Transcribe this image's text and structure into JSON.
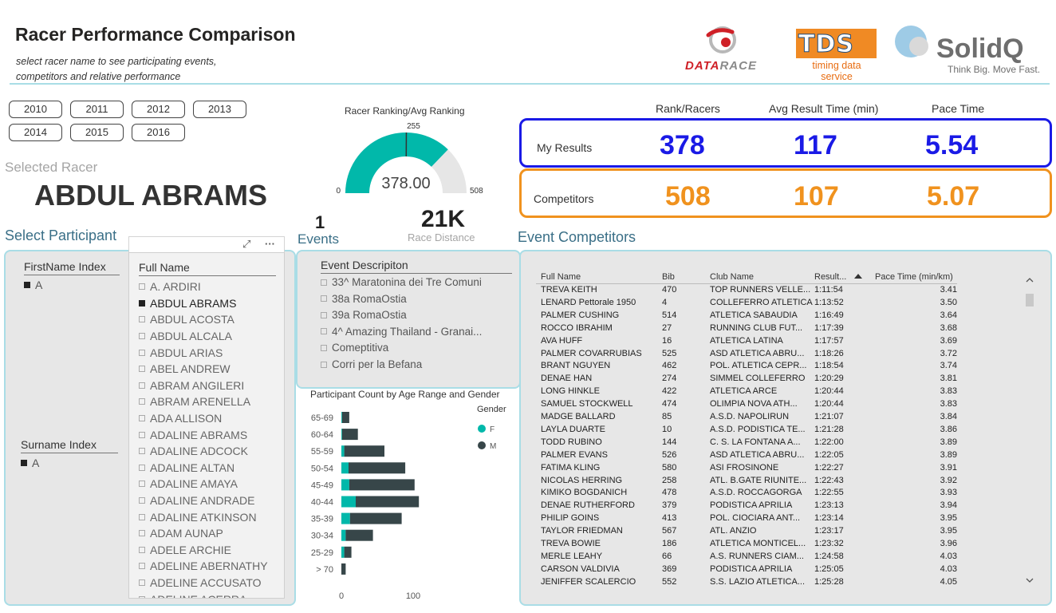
{
  "header": {
    "title": "Racer Performance Comparison",
    "subtitle": "select racer name to see participating events, competitors and relative performance"
  },
  "logos": {
    "datarace_a": "DATA",
    "datarace_b": "RACE",
    "tds": "TDS",
    "tds_tag": "timing data service",
    "solidq": "SolidQ",
    "solidq_tag": "Think Big. Move Fast."
  },
  "years": [
    "2010",
    "2011",
    "2012",
    "2013",
    "2014",
    "2015",
    "2016"
  ],
  "selected_racer": {
    "label": "Selected Racer",
    "name": "ABDUL ABRAMS"
  },
  "select_participant": {
    "title": "Select Participant",
    "firstname_index_label": "FirstName Index",
    "firstname_index_value": "A",
    "surname_index_label": "Surname Index",
    "surname_index_value": "A",
    "full_name_label": "Full Name",
    "names": [
      "A. ARDIRI",
      "ABDUL ABRAMS",
      "ABDUL ACOSTA",
      "ABDUL ALCALA",
      "ABDUL ARIAS",
      "ABEL ANDREW",
      "ABRAM ANGILERI",
      "ABRAM ARENELLA",
      "ADA ALLISON",
      "ADALINE ABRAMS",
      "ADALINE ADCOCK",
      "ADALINE ALTAN",
      "ADALINE AMAYA",
      "ADALINE ANDRADE",
      "ADALINE ATKINSON",
      "ADAM AUNAP",
      "ADELE ARCHIE",
      "ADELINE ABERNATHY",
      "ADELINE ACCUSATO",
      "ADELINE ACERRA"
    ],
    "selected_name": "ABDUL ABRAMS"
  },
  "gauge": {
    "title": "Racer Ranking/Avg Ranking",
    "value": 378,
    "value_label": "378.00",
    "min": 0,
    "max": 508,
    "target": 255,
    "min_label": "0",
    "max_label": "508",
    "target_label": "255",
    "fill_color": "#01b8aa",
    "track_color": "#e6e6e6"
  },
  "events_summary": {
    "count": "1",
    "label": "Events",
    "race_distance": "21K",
    "race_distance_label": "Race Distance"
  },
  "events": {
    "header": "Event Descripiton",
    "items": [
      "33^ Maratonina dei Tre Comuni",
      "38a RomaOstia",
      "39a RomaOstia",
      "4^ Amazing Thailand - Granai...",
      "Comeptitiva",
      "Corri per la Befana"
    ]
  },
  "kpi": {
    "headers": [
      "Rank/Racers",
      "Avg Result Time (min)",
      "Pace Time"
    ],
    "my_results": {
      "label": "My Results",
      "rank": "378",
      "avg_time": "117",
      "pace": "5.54",
      "color": "#1a1ae6"
    },
    "competitors": {
      "label": "Competitors",
      "rank": "508",
      "avg_time": "107",
      "pace": "5.07",
      "color": "#f0921e"
    }
  },
  "event_competitors": {
    "title": "Event Competitors",
    "columns": [
      "Full Name",
      "Bib",
      "Club Name",
      "Result...",
      "Pace Time (min/km)"
    ],
    "rows": [
      [
        "TREVA KEITH",
        "470",
        "TOP RUNNERS VELLE...",
        "1:11:54",
        "3.41"
      ],
      [
        "LENARD Pettorale 1950",
        "4",
        "COLLEFERRO ATLETICA",
        "1:13:52",
        "3.50"
      ],
      [
        "PALMER CUSHING",
        "514",
        "ATLETICA SABAUDIA",
        "1:16:49",
        "3.64"
      ],
      [
        "ROCCO IBRAHIM",
        "27",
        "RUNNING CLUB FUT...",
        "1:17:39",
        "3.68"
      ],
      [
        "AVA HUFF",
        "16",
        "ATLETICA LATINA",
        "1:17:57",
        "3.69"
      ],
      [
        "PALMER COVARRUBIAS",
        "525",
        "ASD ATLETICA ABRU...",
        "1:18:26",
        "3.72"
      ],
      [
        "BRANT NGUYEN",
        "462",
        "POL. ATLETICA CEPR...",
        "1:18:54",
        "3.74"
      ],
      [
        "DENAE HAN",
        "274",
        "SIMMEL COLLEFERRO",
        "1:20:29",
        "3.81"
      ],
      [
        "LONG HINKLE",
        "422",
        "ATLETICA ARCE",
        "1:20:44",
        "3.83"
      ],
      [
        "SAMUEL STOCKWELL",
        "474",
        "OLIMPIA NOVA ATH...",
        "1:20:44",
        "3.83"
      ],
      [
        "MADGE BALLARD",
        "85",
        "A.S.D. NAPOLIRUN",
        "1:21:07",
        "3.84"
      ],
      [
        "LAYLA DUARTE",
        "10",
        "A.S.D. PODISTICA TE...",
        "1:21:28",
        "3.86"
      ],
      [
        "TODD RUBINO",
        "144",
        "C. S. LA FONTANA A...",
        "1:22:00",
        "3.89"
      ],
      [
        "PALMER EVANS",
        "526",
        "ASD ATLETICA ABRU...",
        "1:22:05",
        "3.89"
      ],
      [
        "FATIMA KLING",
        "580",
        "ASI FROSINONE",
        "1:22:27",
        "3.91"
      ],
      [
        "NICOLAS HERRING",
        "258",
        "ATL. B.GATE RIUNITE...",
        "1:22:43",
        "3.92"
      ],
      [
        "KIMIKO BOGDANICH",
        "478",
        "A.S.D. ROCCAGORGA",
        "1:22:55",
        "3.93"
      ],
      [
        "DENAE RUTHERFORD",
        "379",
        "PODISTICA APRILIA",
        "1:23:13",
        "3.94"
      ],
      [
        "PHILIP GOINS",
        "413",
        "POL. CIOCIARA ANT...",
        "1:23:14",
        "3.95"
      ],
      [
        "TAYLOR FRIEDMAN",
        "567",
        "ATL. ANZIO",
        "1:23:17",
        "3.95"
      ],
      [
        "TREVA BOWIE",
        "186",
        "ATLETICA MONTICEL...",
        "1:23:32",
        "3.96"
      ],
      [
        "MERLE LEAHY",
        "66",
        "A.S. RUNNERS CIAM...",
        "1:24:58",
        "4.03"
      ],
      [
        "CARSON VALDIVIA",
        "369",
        "PODISTICA APRILIA",
        "1:25:05",
        "4.03"
      ],
      [
        "JENIFFER SCALERCIO",
        "552",
        "S.S. LAZIO ATLETICA...",
        "1:25:28",
        "4.05"
      ]
    ]
  },
  "chart_data": {
    "type": "bar",
    "orientation": "horizontal",
    "stacked": true,
    "title": "Participant Count by Age Range and Gender",
    "legend_title": "Gender",
    "legend_position": "top-right",
    "categories": [
      "65-69",
      "60-64",
      "55-59",
      "50-54",
      "45-49",
      "40-44",
      "35-39",
      "30-34",
      "25-29",
      "> 70"
    ],
    "series": [
      {
        "name": "F",
        "color": "#01b8aa",
        "values": [
          1,
          1,
          4,
          10,
          11,
          20,
          12,
          6,
          4,
          0
        ]
      },
      {
        "name": "M",
        "color": "#374649",
        "values": [
          10,
          22,
          56,
          79,
          91,
          88,
          72,
          38,
          10,
          6
        ]
      }
    ],
    "xlim": [
      0,
      110
    ],
    "x_ticks": [
      "0",
      "100"
    ],
    "grid": false
  }
}
